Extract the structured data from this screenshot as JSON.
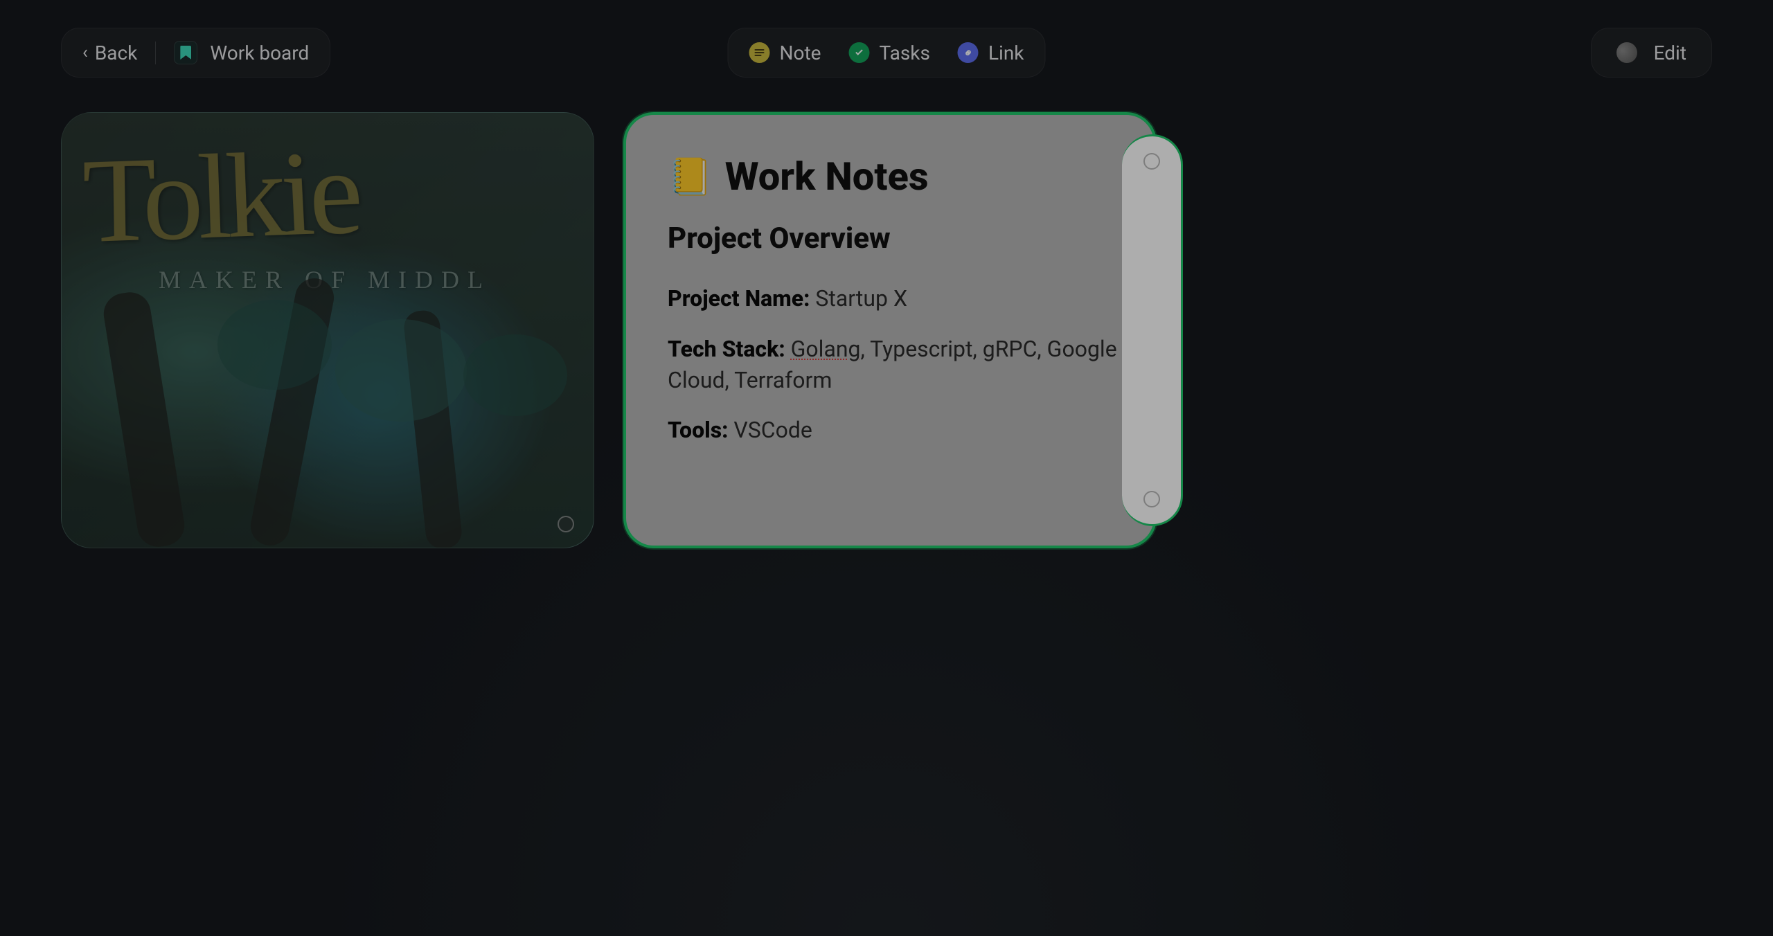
{
  "toolbar": {
    "back_label": "Back",
    "board_name": "Work board",
    "actions": {
      "note": "Note",
      "tasks": "Tasks",
      "link": "Link"
    },
    "edit_label": "Edit"
  },
  "cards": {
    "image_card": {
      "book_title_text": "Tolkie",
      "book_subtitle_text": "MAKER OF MIDDL"
    },
    "note_card": {
      "emoji": "📒",
      "title": "Work Notes",
      "heading": "Project Overview",
      "project_name_label": "Project Name:",
      "project_name_value": " Startup X",
      "tech_stack_label": "Tech Stack:",
      "tech_stack_value_spellcheck": "Golang",
      "tech_stack_value_rest": ", Typescript, gRPC, Google Cloud, Terraform",
      "tools_label": "Tools:",
      "tools_value": " VSCode"
    }
  },
  "colors": {
    "accent_select": "#1fc76b",
    "note_icon": "#c9b83f",
    "tasks_icon": "#14a35a",
    "link_icon": "#5d6eed"
  }
}
